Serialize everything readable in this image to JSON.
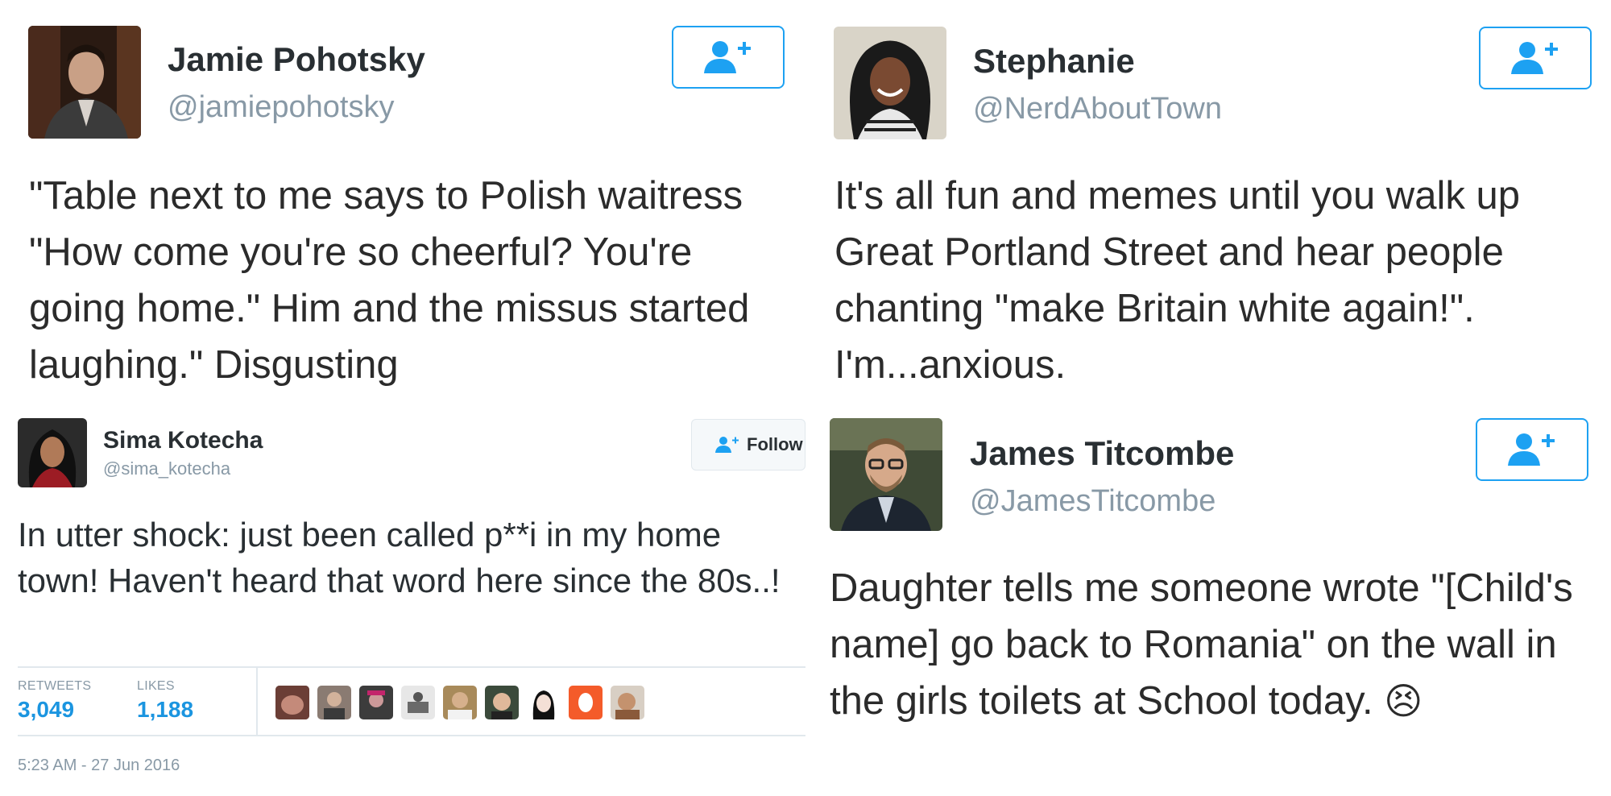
{
  "tweets": [
    {
      "name": "Jamie Pohotsky",
      "handle": "@jamiepohotsky",
      "text": "\"Table next to me says to Polish waitress \"How come you're so cheerful? You're going home.\" Him and the missus started laughing.\" Disgusting",
      "follow_icon": "add-user-icon"
    },
    {
      "name": "Stephanie",
      "handle": "@NerdAboutTown",
      "text": "It's all fun and memes until you walk up Great Portland Street and hear people chanting \"make Britain white again!\". I'm...anxious.",
      "follow_icon": "add-user-icon"
    },
    {
      "name": "Sima Kotecha",
      "handle": "@sima_kotecha",
      "follow_label": "Follow",
      "text": "In utter shock: just been called p**i in my home town! Haven't heard that word here since the 80s..!",
      "retweets_label": "RETWEETS",
      "retweets_value": "3,049",
      "likes_label": "LIKES",
      "likes_value": "1,188",
      "timestamp": "5:23 AM - 27 Jun 2016"
    },
    {
      "name": "James Titcombe",
      "handle": "@JamesTitcombe",
      "text": "Daughter tells me someone wrote \"[Child's name] go back to Romania\" on the wall in the girls toilets at School today.",
      "emoji": "😣",
      "follow_icon": "add-user-icon"
    }
  ],
  "colors": {
    "accent": "#1da1f2",
    "stat_blue": "#1b95e0",
    "muted": "#8899a6",
    "text": "#292f33"
  }
}
